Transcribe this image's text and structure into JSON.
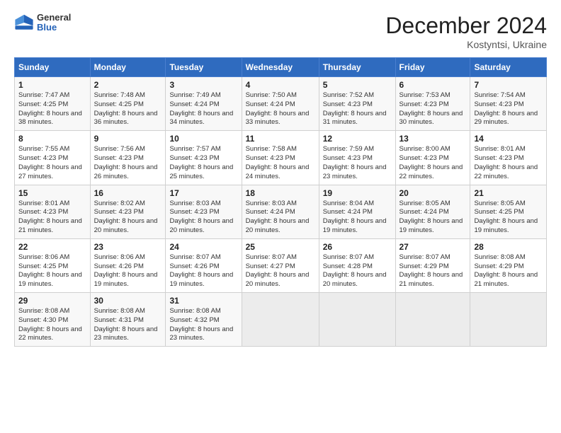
{
  "header": {
    "logo": {
      "general": "General",
      "blue": "Blue"
    },
    "title": "December 2024",
    "subtitle": "Kostyntsi, Ukraine"
  },
  "weekdays": [
    "Sunday",
    "Monday",
    "Tuesday",
    "Wednesday",
    "Thursday",
    "Friday",
    "Saturday"
  ],
  "weeks": [
    [
      {
        "day": "1",
        "sunrise": "Sunrise: 7:47 AM",
        "sunset": "Sunset: 4:25 PM",
        "daylight": "Daylight: 8 hours and 38 minutes."
      },
      {
        "day": "2",
        "sunrise": "Sunrise: 7:48 AM",
        "sunset": "Sunset: 4:25 PM",
        "daylight": "Daylight: 8 hours and 36 minutes."
      },
      {
        "day": "3",
        "sunrise": "Sunrise: 7:49 AM",
        "sunset": "Sunset: 4:24 PM",
        "daylight": "Daylight: 8 hours and 34 minutes."
      },
      {
        "day": "4",
        "sunrise": "Sunrise: 7:50 AM",
        "sunset": "Sunset: 4:24 PM",
        "daylight": "Daylight: 8 hours and 33 minutes."
      },
      {
        "day": "5",
        "sunrise": "Sunrise: 7:52 AM",
        "sunset": "Sunset: 4:23 PM",
        "daylight": "Daylight: 8 hours and 31 minutes."
      },
      {
        "day": "6",
        "sunrise": "Sunrise: 7:53 AM",
        "sunset": "Sunset: 4:23 PM",
        "daylight": "Daylight: 8 hours and 30 minutes."
      },
      {
        "day": "7",
        "sunrise": "Sunrise: 7:54 AM",
        "sunset": "Sunset: 4:23 PM",
        "daylight": "Daylight: 8 hours and 29 minutes."
      }
    ],
    [
      {
        "day": "8",
        "sunrise": "Sunrise: 7:55 AM",
        "sunset": "Sunset: 4:23 PM",
        "daylight": "Daylight: 8 hours and 27 minutes."
      },
      {
        "day": "9",
        "sunrise": "Sunrise: 7:56 AM",
        "sunset": "Sunset: 4:23 PM",
        "daylight": "Daylight: 8 hours and 26 minutes."
      },
      {
        "day": "10",
        "sunrise": "Sunrise: 7:57 AM",
        "sunset": "Sunset: 4:23 PM",
        "daylight": "Daylight: 8 hours and 25 minutes."
      },
      {
        "day": "11",
        "sunrise": "Sunrise: 7:58 AM",
        "sunset": "Sunset: 4:23 PM",
        "daylight": "Daylight: 8 hours and 24 minutes."
      },
      {
        "day": "12",
        "sunrise": "Sunrise: 7:59 AM",
        "sunset": "Sunset: 4:23 PM",
        "daylight": "Daylight: 8 hours and 23 minutes."
      },
      {
        "day": "13",
        "sunrise": "Sunrise: 8:00 AM",
        "sunset": "Sunset: 4:23 PM",
        "daylight": "Daylight: 8 hours and 22 minutes."
      },
      {
        "day": "14",
        "sunrise": "Sunrise: 8:01 AM",
        "sunset": "Sunset: 4:23 PM",
        "daylight": "Daylight: 8 hours and 22 minutes."
      }
    ],
    [
      {
        "day": "15",
        "sunrise": "Sunrise: 8:01 AM",
        "sunset": "Sunset: 4:23 PM",
        "daylight": "Daylight: 8 hours and 21 minutes."
      },
      {
        "day": "16",
        "sunrise": "Sunrise: 8:02 AM",
        "sunset": "Sunset: 4:23 PM",
        "daylight": "Daylight: 8 hours and 20 minutes."
      },
      {
        "day": "17",
        "sunrise": "Sunrise: 8:03 AM",
        "sunset": "Sunset: 4:23 PM",
        "daylight": "Daylight: 8 hours and 20 minutes."
      },
      {
        "day": "18",
        "sunrise": "Sunrise: 8:03 AM",
        "sunset": "Sunset: 4:24 PM",
        "daylight": "Daylight: 8 hours and 20 minutes."
      },
      {
        "day": "19",
        "sunrise": "Sunrise: 8:04 AM",
        "sunset": "Sunset: 4:24 PM",
        "daylight": "Daylight: 8 hours and 19 minutes."
      },
      {
        "day": "20",
        "sunrise": "Sunrise: 8:05 AM",
        "sunset": "Sunset: 4:24 PM",
        "daylight": "Daylight: 8 hours and 19 minutes."
      },
      {
        "day": "21",
        "sunrise": "Sunrise: 8:05 AM",
        "sunset": "Sunset: 4:25 PM",
        "daylight": "Daylight: 8 hours and 19 minutes."
      }
    ],
    [
      {
        "day": "22",
        "sunrise": "Sunrise: 8:06 AM",
        "sunset": "Sunset: 4:25 PM",
        "daylight": "Daylight: 8 hours and 19 minutes."
      },
      {
        "day": "23",
        "sunrise": "Sunrise: 8:06 AM",
        "sunset": "Sunset: 4:26 PM",
        "daylight": "Daylight: 8 hours and 19 minutes."
      },
      {
        "day": "24",
        "sunrise": "Sunrise: 8:07 AM",
        "sunset": "Sunset: 4:26 PM",
        "daylight": "Daylight: 8 hours and 19 minutes."
      },
      {
        "day": "25",
        "sunrise": "Sunrise: 8:07 AM",
        "sunset": "Sunset: 4:27 PM",
        "daylight": "Daylight: 8 hours and 20 minutes."
      },
      {
        "day": "26",
        "sunrise": "Sunrise: 8:07 AM",
        "sunset": "Sunset: 4:28 PM",
        "daylight": "Daylight: 8 hours and 20 minutes."
      },
      {
        "day": "27",
        "sunrise": "Sunrise: 8:07 AM",
        "sunset": "Sunset: 4:29 PM",
        "daylight": "Daylight: 8 hours and 21 minutes."
      },
      {
        "day": "28",
        "sunrise": "Sunrise: 8:08 AM",
        "sunset": "Sunset: 4:29 PM",
        "daylight": "Daylight: 8 hours and 21 minutes."
      }
    ],
    [
      {
        "day": "29",
        "sunrise": "Sunrise: 8:08 AM",
        "sunset": "Sunset: 4:30 PM",
        "daylight": "Daylight: 8 hours and 22 minutes."
      },
      {
        "day": "30",
        "sunrise": "Sunrise: 8:08 AM",
        "sunset": "Sunset: 4:31 PM",
        "daylight": "Daylight: 8 hours and 23 minutes."
      },
      {
        "day": "31",
        "sunrise": "Sunrise: 8:08 AM",
        "sunset": "Sunset: 4:32 PM",
        "daylight": "Daylight: 8 hours and 23 minutes."
      },
      null,
      null,
      null,
      null
    ]
  ]
}
